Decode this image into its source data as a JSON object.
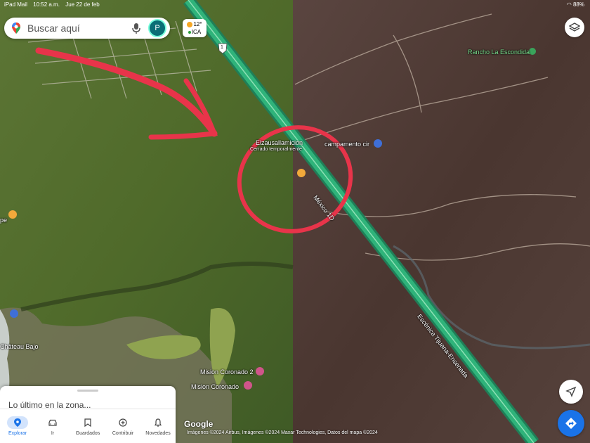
{
  "status": {
    "device": "iPad Mail",
    "time": "10:52 a.m.",
    "date": "Jue 22 de feb",
    "battery": "88%"
  },
  "search": {
    "placeholder": "Buscar aquí",
    "avatar_letter": "P"
  },
  "weather": {
    "temp": "12°",
    "aqi": "ICA"
  },
  "map_labels": {
    "route_shield": "1",
    "place_1": "Elzausallamicion",
    "place_1_sub": "Cerrado temporalmente",
    "place_2": "campamento cir",
    "place_3": "Rancho La Escondida",
    "road_1": "México 1D",
    "road_2": "Escénica Tijuana-Ensenada",
    "place_4": "Mision Coronado 2",
    "place_5": "Mision Coronado",
    "place_6": "Château Bajo",
    "place_7": "pe"
  },
  "sheet": {
    "title": "Lo último en la zona..."
  },
  "tabs": [
    {
      "label": "Explorar",
      "icon": "location-pin-icon",
      "active": true
    },
    {
      "label": "Ir",
      "icon": "car-icon",
      "active": false
    },
    {
      "label": "Guardados",
      "icon": "bookmark-icon",
      "active": false
    },
    {
      "label": "Contribuir",
      "icon": "add-circle-icon",
      "active": false
    },
    {
      "label": "Novedades",
      "icon": "bell-icon",
      "active": false
    }
  ],
  "attribution": {
    "logo": "Google",
    "text": "Imágenes ©2024 Airbus, Imágenes ©2024 Maxar Technologies, Datos del mapa ©2024"
  },
  "colors": {
    "left_terrain": "#4f6a2a",
    "right_terrain": "#4a3630",
    "highway": "#2fb37a",
    "annotation": "#e8344a",
    "accent": "#1a73e8"
  }
}
